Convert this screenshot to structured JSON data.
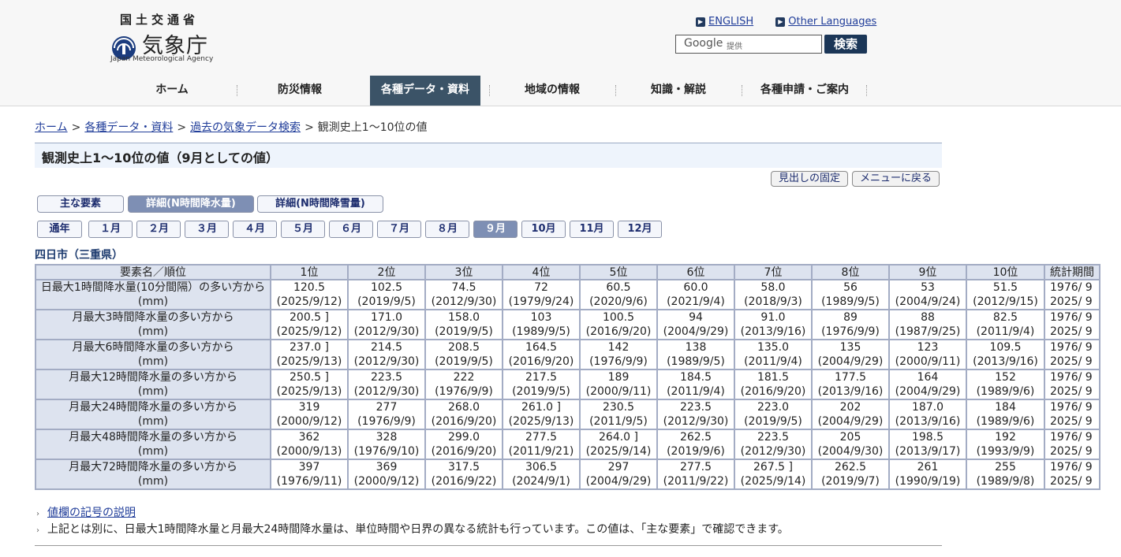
{
  "header": {
    "ministry": "国土交通省",
    "agency": "気象庁",
    "agency_en": "Japan Meteorological Agency",
    "lang_english": "ENGLISH",
    "lang_other": "Other Languages",
    "search_google": "Google",
    "search_placeholder": "提供",
    "search_button": "検索"
  },
  "nav": [
    "ホーム",
    "防災情報",
    "各種データ・資料",
    "地域の情報",
    "知識・解説",
    "各種申請・ご案内"
  ],
  "breadcrumb": {
    "home": "ホーム",
    "data": "各種データ・資料",
    "past": "過去の気象データ検索",
    "current": "観測史上1～10位の値",
    "sep": ">"
  },
  "page_title": "観測史上1～10位の値（9月としての値）",
  "buttons": {
    "fix_heading": "見出しの固定",
    "back_menu": "メニューに戻る"
  },
  "tabs": [
    "主な要素",
    "詳細(N時間降水量)",
    "詳細(N時間降雪量)"
  ],
  "months": [
    "通年",
    "１月",
    "２月",
    "３月",
    "４月",
    "５月",
    "６月",
    "７月",
    "８月",
    "９月",
    "10月",
    "11月",
    "12月"
  ],
  "station": "四日市（三重県）",
  "table": {
    "header_elem": "要素名／順位",
    "ranks": [
      "1位",
      "2位",
      "3位",
      "4位",
      "5位",
      "6位",
      "7位",
      "8位",
      "9位",
      "10位"
    ],
    "header_period": "統計期間",
    "rows": [
      {
        "name1": "日最大1時間降水量(10分間隔）の多い方から",
        "name2": "(mm)",
        "values": [
          "120.5",
          "102.5",
          "74.5",
          "72",
          "60.5",
          "60.0",
          "58.0",
          "56",
          "53",
          "51.5"
        ],
        "dates": [
          "(2025/9/12)",
          "(2019/9/5)",
          "(2012/9/30)",
          "(1979/9/24)",
          "(2020/9/6)",
          "(2021/9/4)",
          "(2018/9/3)",
          "(1989/9/5)",
          "(2004/9/24)",
          "(2012/9/15)"
        ],
        "period1": "1976/ 9",
        "period2": "2025/ 9"
      },
      {
        "name1": "月最大3時間降水量の多い方から",
        "name2": "(mm)",
        "values": [
          "200.5 ]",
          "171.0",
          "158.0",
          "103",
          "100.5",
          "94",
          "91.0",
          "89",
          "88",
          "82.5"
        ],
        "dates": [
          "(2025/9/12)",
          "(2012/9/30)",
          "(2019/9/5)",
          "(1989/9/5)",
          "(2016/9/20)",
          "(2004/9/29)",
          "(2013/9/16)",
          "(1976/9/9)",
          "(1987/9/25)",
          "(2011/9/4)"
        ],
        "period1": "1976/ 9",
        "period2": "2025/ 9"
      },
      {
        "name1": "月最大6時間降水量の多い方から",
        "name2": "(mm)",
        "values": [
          "237.0 ]",
          "214.5",
          "208.5",
          "164.5",
          "142",
          "138",
          "135.0",
          "135",
          "123",
          "109.5"
        ],
        "dates": [
          "(2025/9/13)",
          "(2012/9/30)",
          "(2019/9/5)",
          "(2016/9/20)",
          "(1976/9/9)",
          "(1989/9/5)",
          "(2011/9/4)",
          "(2004/9/29)",
          "(2000/9/11)",
          "(2013/9/16)"
        ],
        "period1": "1976/ 9",
        "period2": "2025/ 9"
      },
      {
        "name1": "月最大12時間降水量の多い方から",
        "name2": "(mm)",
        "values": [
          "250.5 ]",
          "223.5",
          "222",
          "217.5",
          "189",
          "184.5",
          "181.5",
          "177.5",
          "164",
          "152"
        ],
        "dates": [
          "(2025/9/13)",
          "(2012/9/30)",
          "(1976/9/9)",
          "(2019/9/5)",
          "(2000/9/11)",
          "(2011/9/4)",
          "(2016/9/20)",
          "(2013/9/16)",
          "(2004/9/29)",
          "(1989/9/6)"
        ],
        "period1": "1976/ 9",
        "period2": "2025/ 9"
      },
      {
        "name1": "月最大24時間降水量の多い方から",
        "name2": "(mm)",
        "values": [
          "319",
          "277",
          "268.0",
          "261.0 ]",
          "230.5",
          "223.5",
          "223.0",
          "202",
          "187.0",
          "184"
        ],
        "dates": [
          "(2000/9/12)",
          "(1976/9/9)",
          "(2016/9/20)",
          "(2025/9/13)",
          "(2011/9/5)",
          "(2012/9/30)",
          "(2019/9/5)",
          "(2004/9/29)",
          "(2013/9/16)",
          "(1989/9/6)"
        ],
        "period1": "1976/ 9",
        "period2": "2025/ 9"
      },
      {
        "name1": "月最大48時間降水量の多い方から",
        "name2": "(mm)",
        "values": [
          "362",
          "328",
          "299.0",
          "277.5",
          "264.0 ]",
          "262.5",
          "223.5",
          "205",
          "198.5",
          "192"
        ],
        "dates": [
          "(2000/9/13)",
          "(1976/9/10)",
          "(2016/9/20)",
          "(2011/9/21)",
          "(2025/9/14)",
          "(2019/9/6)",
          "(2012/9/30)",
          "(2004/9/30)",
          "(2013/9/17)",
          "(1993/9/9)"
        ],
        "period1": "1976/ 9",
        "period2": "2025/ 9"
      },
      {
        "name1": "月最大72時間降水量の多い方から",
        "name2": "(mm)",
        "values": [
          "397",
          "369",
          "317.5",
          "306.5",
          "297",
          "277.5",
          "267.5 ]",
          "262.5",
          "261",
          "255"
        ],
        "dates": [
          "(1976/9/11)",
          "(2000/9/12)",
          "(2016/9/22)",
          "(2024/9/1)",
          "(2004/9/29)",
          "(2011/9/22)",
          "(2025/9/14)",
          "(2019/9/7)",
          "(1990/9/19)",
          "(1989/9/8)"
        ],
        "period1": "1976/ 9",
        "period2": "2025/ 9"
      }
    ]
  },
  "notes": {
    "link": "値欄の記号の説明",
    "text": "上記とは別に、日最大1時間降水量と月最大24時間降水量は、単位時間や日界の異なる統計も行っています。この値は、「主な要素」で確認できます。"
  },
  "colors": {
    "nav_active": "#3b5367",
    "tab_selected": "#7e8fb4",
    "table_header": "#dde3ef",
    "link": "#1f3c99"
  }
}
